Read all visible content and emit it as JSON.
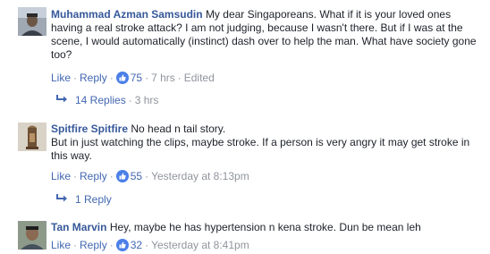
{
  "comments": [
    {
      "author": "Muhammad Azman Samsudin",
      "text": "My dear Singaporeans. What if it is your loved ones having a real stroke attack? I am not judging, because I wasn't there. But if I was at the scene, I would automatically (instinct) dash over to help the man. What have society gone too?",
      "like_label": "Like",
      "reply_label": "Reply",
      "reactions": "75",
      "time": "7 hrs",
      "edited": "Edited",
      "replies_label": "14 Replies",
      "replies_time": "3 hrs",
      "avatar_icon": "profile-photo"
    },
    {
      "author": "Spitfire Spitfire",
      "text": "No head n tail story.",
      "text2": "But in just watching the clips, maybe stroke. If a person is very angry it may get stroke in this way.",
      "like_label": "Like",
      "reply_label": "Reply",
      "reactions": "55",
      "time": "Yesterday at 8:13pm",
      "replies_label": "1 Reply",
      "avatar_icon": "profile-photo"
    },
    {
      "author": "Tan Marvin",
      "text": "Hey, maybe he has hypertension n kena stroke. Dun be mean leh",
      "like_label": "Like",
      "reply_label": "Reply",
      "reactions": "32",
      "time": "Yesterday at 8:41pm",
      "avatar_icon": "profile-photo"
    }
  ],
  "colors": {
    "author": "#365899",
    "link": "#4267b2",
    "meta": "#90949c",
    "text": "#1d2129"
  }
}
